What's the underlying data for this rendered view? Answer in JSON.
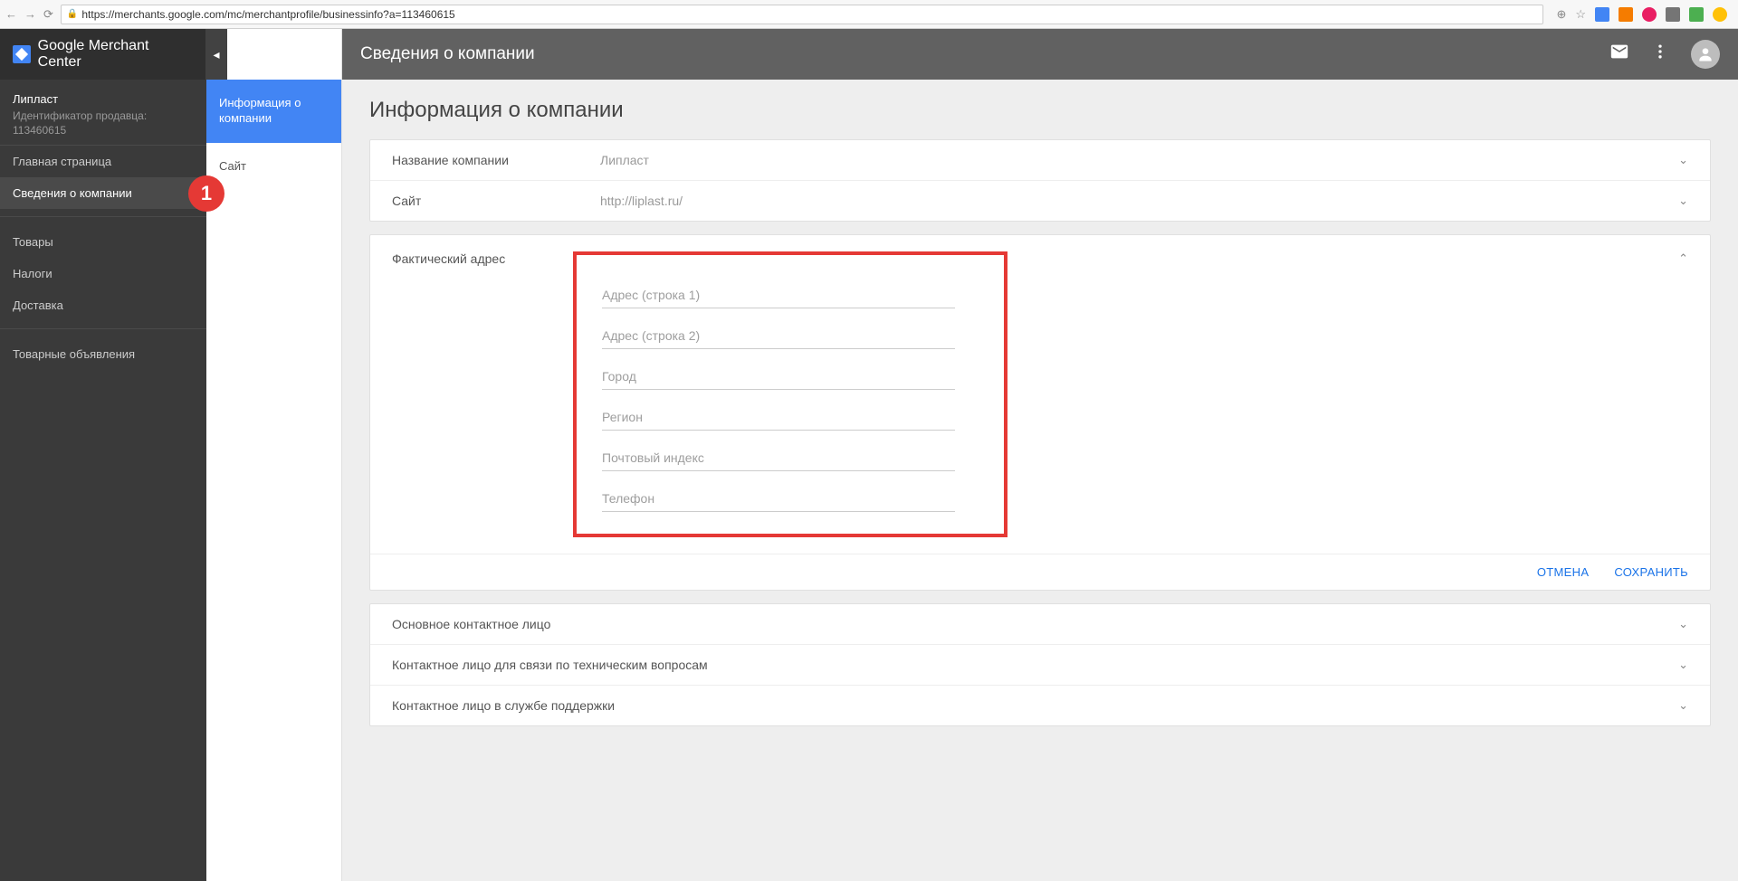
{
  "browser": {
    "url": "https://merchants.google.com/mc/merchantprofile/businessinfo?a=113460615"
  },
  "sidebar": {
    "logo": "Google Merchant Center",
    "account_name": "Липласт",
    "account_sub": "Идентификатор продавца: 113460615",
    "items": [
      {
        "label": "Главная страница"
      },
      {
        "label": "Сведения о компании"
      },
      {
        "label": "Товары"
      },
      {
        "label": "Налоги"
      },
      {
        "label": "Доставка"
      },
      {
        "label": "Товарные объявления"
      }
    ],
    "badge": "1"
  },
  "subside": {
    "items": [
      {
        "label": "Информация о компании"
      },
      {
        "label": "Сайт"
      }
    ]
  },
  "header": {
    "title": "Сведения о компании"
  },
  "page": {
    "title": "Информация о компании",
    "rows": {
      "company_label": "Название компании",
      "company_value": "Липласт",
      "site_label": "Сайт",
      "site_value": "http://liplast.ru/"
    },
    "address": {
      "label": "Фактический адрес",
      "fields": {
        "line1": "Адрес (строка 1)",
        "line2": "Адрес (строка 2)",
        "city": "Город",
        "region": "Регион",
        "postal": "Почтовый индекс",
        "phone": "Телефон"
      },
      "cancel": "ОТМЕНА",
      "save": "СОХРАНИТЬ"
    },
    "contacts": {
      "primary": "Основное контактное лицо",
      "tech": "Контактное лицо для связи по техническим вопросам",
      "support": "Контактное лицо в службе поддержки"
    }
  }
}
